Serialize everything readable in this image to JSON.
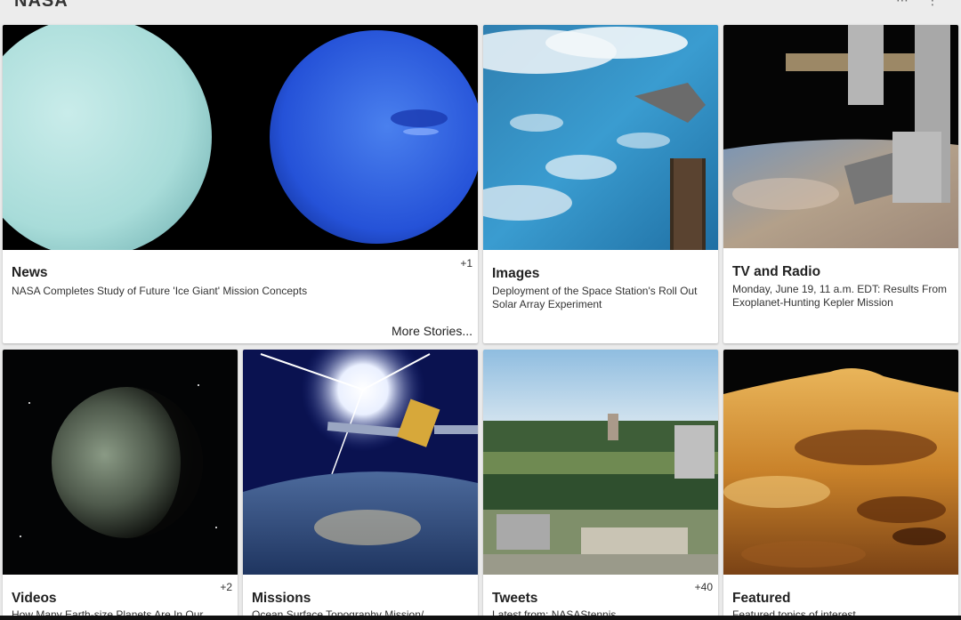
{
  "app": {
    "title": "NASA"
  },
  "tiles": [
    {
      "title": "News",
      "subtitle": "NASA Completes Study of Future 'Ice Giant' Mission Concepts",
      "count": "+1",
      "more": "More Stories..."
    },
    {
      "title": "Images",
      "subtitle": "Deployment of the Space Station's Roll Out Solar Array Experiment"
    },
    {
      "title": "TV and Radio",
      "subtitle": "Monday, June 19, 11 a.m. EDT: Results From Exoplanet-Hunting Kepler Mission"
    },
    {
      "title": "Videos",
      "subtitle": "How Many Earth-size Planets Are In Our",
      "count": "+2"
    },
    {
      "title": "Missions",
      "subtitle": "Ocean Surface Topography Mission/"
    },
    {
      "title": "Tweets",
      "subtitle": "Latest from: NASAStennis",
      "count": "+40"
    },
    {
      "title": "Featured",
      "subtitle": "Featured topics of interest"
    }
  ],
  "icons": [
    "share-icon",
    "more-vert-icon"
  ]
}
